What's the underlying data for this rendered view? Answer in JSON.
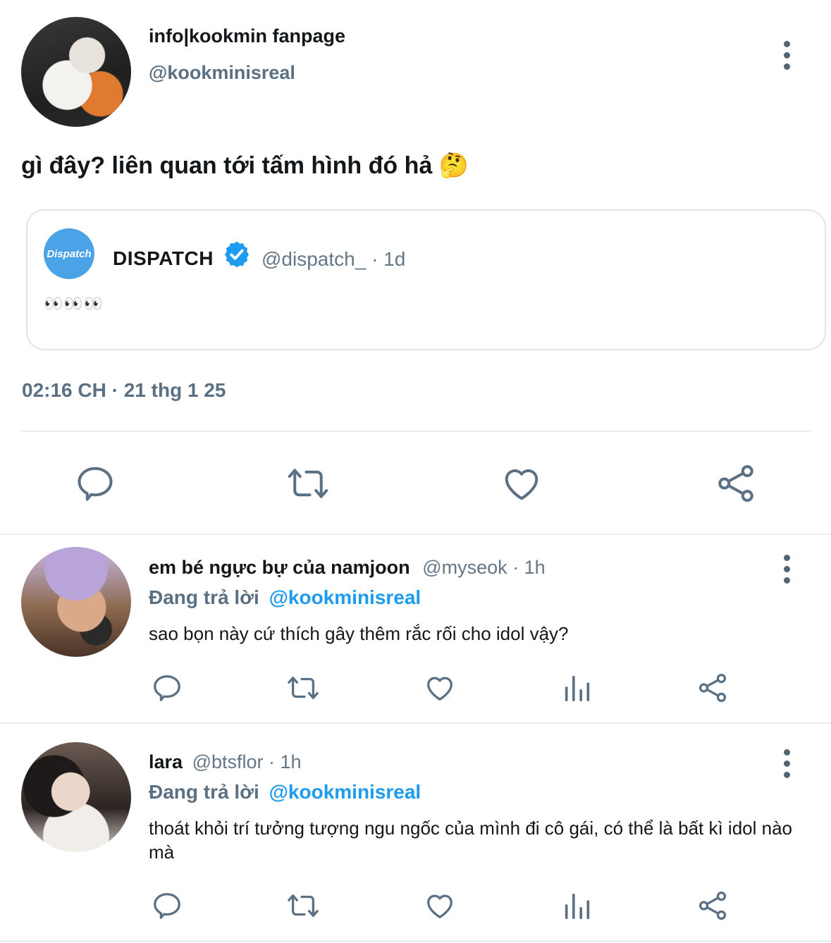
{
  "main_tweet": {
    "name": "info|kookmin fanpage",
    "handle": "@kookminisreal",
    "text": "gì đây? liên quan tới tấm hình đó hả 🤔",
    "timestamp": "02:16 CH · 21 thg 1 25",
    "quoted": {
      "logo_text": "Dispatch",
      "name": "DISPATCH",
      "meta": "@dispatch_ · 1d",
      "text": "👀👀👀"
    }
  },
  "replies": [
    {
      "name": "em bé ngực bự của namjoon",
      "meta": "@myseok · 1h",
      "replying_label": "Đang trả lời",
      "replying_handle": "@kookminisreal",
      "text": "sao bọn này cứ thích gây thêm rắc rối cho idol vậy?"
    },
    {
      "name": "lara",
      "meta": "@btsflor · 1h",
      "replying_label": "Đang trả lời",
      "replying_handle": "@kookminisreal",
      "text": "thoát khỏi trí tưởng tượng ngu ngốc của mình đi cô gái, có thể là bất kì idol nào mà"
    }
  ],
  "colors": {
    "accent": "#1d9bf0",
    "icon": "#5b7083",
    "divider": "#e6ecf0"
  }
}
